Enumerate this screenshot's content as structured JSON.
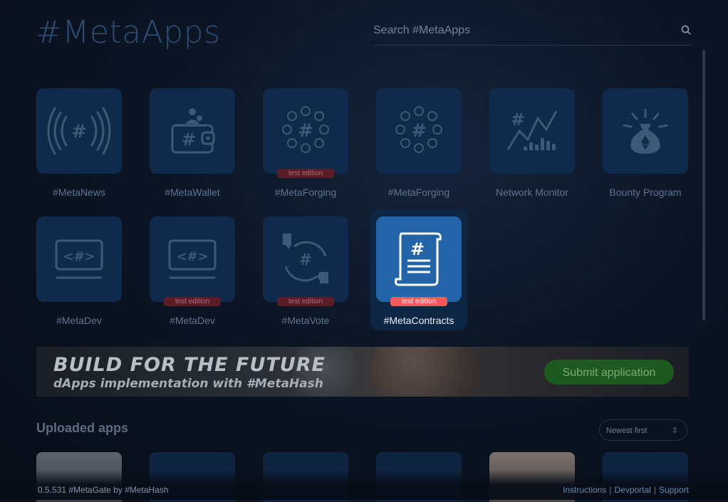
{
  "header": {
    "title": "#MetaApps",
    "search_placeholder": "Search #MetaApps",
    "search_icon": "search-icon"
  },
  "apps": [
    {
      "label": "#MetaNews",
      "icon": "broadcast-icon"
    },
    {
      "label": "#MetaWallet",
      "icon": "wallet-icon"
    },
    {
      "label": "#MetaForging",
      "icon": "forging-ring-icon",
      "badge": "test edition"
    },
    {
      "label": "#MetaForging",
      "icon": "forging-ring-icon"
    },
    {
      "label": "Network Monitor",
      "icon": "network-chart-icon"
    },
    {
      "label": "Bounty Program",
      "icon": "money-bag-icon"
    },
    {
      "label": "#MetaDev",
      "icon": "code-monitor-icon"
    },
    {
      "label": "#MetaDev",
      "icon": "code-monitor-icon",
      "badge": "test edition"
    },
    {
      "label": "#MetaVote",
      "icon": "vote-thumbs-icon",
      "badge": "test edition"
    },
    {
      "label": "#MetaContracts",
      "icon": "contract-scroll-icon",
      "badge": "test edition",
      "selected": true
    }
  ],
  "banner": {
    "title": "BUILD FOR THE FUTURE",
    "subtitle": "dApps implementation with #MetaHash",
    "button": "Submit application"
  },
  "uploaded": {
    "title": "Uploaded apps",
    "sort_value": "Newest first"
  },
  "footer": {
    "version": "0.5.531 #MetaGate by #MetaHash",
    "links": [
      "Instructions",
      "Devportal",
      "Support"
    ],
    "separator": "|"
  },
  "colors": {
    "tile": "#0f2a4a",
    "tile_active": "#2364a8",
    "badge": "#f05a5a",
    "accent_green": "#1d5a1f"
  }
}
